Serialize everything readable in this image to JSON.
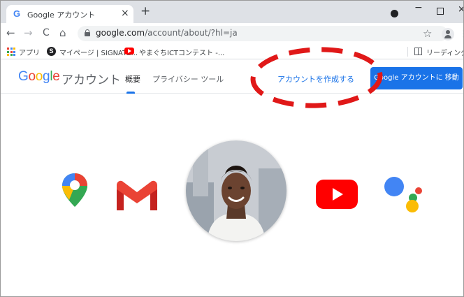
{
  "browser": {
    "tab_title": "Google アカウント",
    "tab_favicon": "G",
    "tab_close": "×",
    "new_tab": "+",
    "url_host": "google.com",
    "url_path": "/account/about/?hl=ja",
    "back_icon": "←",
    "forward_icon": "→",
    "reload_icon": "C",
    "home_icon": "⌂",
    "star_icon": "☆",
    "menu_icon": "⋮",
    "minimize": "−",
    "close": "×"
  },
  "bookmarks": {
    "apps_label": "アプリ",
    "items": [
      {
        "label": "マイページ | SIGNATE..."
      },
      {
        "label": "やまぐちICTコンテスト -..."
      }
    ],
    "reading_list": "リーディング リスト"
  },
  "header": {
    "logo": [
      "G",
      "o",
      "o",
      "g",
      "l",
      "e"
    ],
    "logo_colors": [
      "#4285F4",
      "#EA4335",
      "#FBBC05",
      "#4285F4",
      "#34A853",
      "#EA4335"
    ],
    "title": "アカウント",
    "tabs": [
      {
        "label": "概要",
        "active": true
      },
      {
        "label": "プライバシー ツール",
        "active": false
      }
    ],
    "create_account_link": "アカウントを作成する",
    "go_button": "Google アカウントに 移動"
  },
  "annotation": {
    "color": "#e01818",
    "style": "dashed-oval"
  },
  "products": [
    "maps-icon",
    "gmail-icon",
    "portrait",
    "youtube-icon",
    "assistant-icon"
  ]
}
